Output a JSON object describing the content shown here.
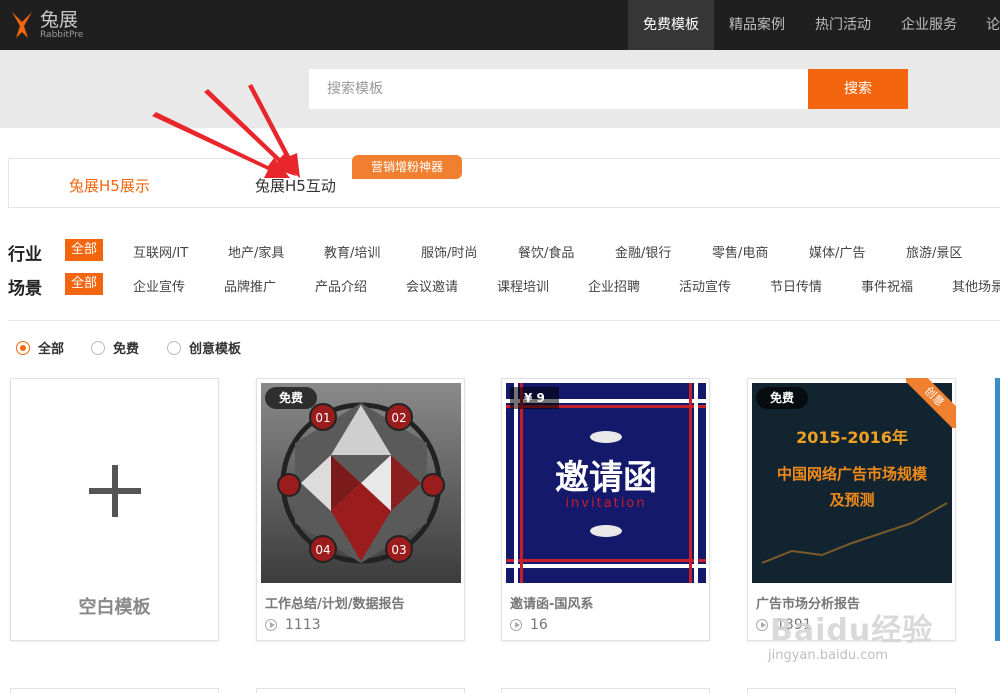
{
  "app": {
    "logo_cn": "兔展",
    "logo_en": "RabbitPre"
  },
  "nav": {
    "items": [
      "免费模板",
      "精品案例",
      "热门活动",
      "企业服务",
      "论"
    ]
  },
  "search": {
    "placeholder": "搜索模板",
    "button": "搜索"
  },
  "product_tabs": {
    "tab1": "兔展H5展示",
    "tab2": "兔展H5互动",
    "badge": "营销增粉神器"
  },
  "filters": {
    "industry_label": "行业",
    "scene_label": "场景",
    "all_label": "全部",
    "industry": [
      "互联网/IT",
      "地产/家具",
      "教育/培训",
      "服饰/时尚",
      "餐饮/食品",
      "金融/银行",
      "零售/电商",
      "媒体/广告",
      "旅游/景区"
    ],
    "scene": [
      "企业宣传",
      "品牌推广",
      "产品介绍",
      "会议邀请",
      "课程培训",
      "企业招聘",
      "活动宣传",
      "节日传情",
      "事件祝福",
      "其他场景"
    ]
  },
  "price_filter": {
    "options": [
      "全部",
      "免费",
      "创意模板"
    ],
    "selected": "全部"
  },
  "cards": {
    "blank_title": "空白模板",
    "items": [
      {
        "tag": "免费",
        "title": "工作总结/计划/数据报告",
        "views": "1113",
        "thumb_labels": [
          "01",
          "02",
          "03",
          "04"
        ]
      },
      {
        "tag": "¥ 9",
        "title": "邀请函-国风系",
        "views": "16",
        "thumb_title": "邀请函",
        "thumb_sub": "invitation"
      },
      {
        "tag": "免费",
        "title": "广告市场分析报告",
        "views": "1391",
        "ribbon": "创意",
        "thumb_line1": "2015-2016年",
        "thumb_line2": "中国网络广告市场规模",
        "thumb_line3": "及预测"
      }
    ]
  },
  "watermark": {
    "text": "Baidu经验",
    "url": "jingyan.baidu.com"
  },
  "colors": {
    "accent": "#f3660f",
    "nav_bg": "#1f1f1f",
    "nav_active_bg": "#363636",
    "annotation_arrow": "#e8272c"
  }
}
